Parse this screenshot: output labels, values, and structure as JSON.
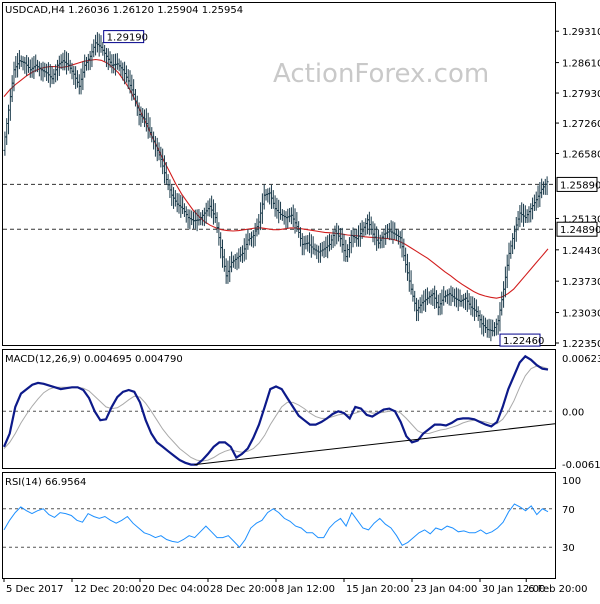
{
  "chart_data": {
    "type": "line",
    "symbol": "USDCAD",
    "timeframe": "H4",
    "header": {
      "text": "USDCAD,H4  1.26036 1.26120 1.25904 1.25954",
      "values": [
        1.26036,
        1.2612,
        1.25904,
        1.25954
      ]
    },
    "watermark": "ActionForex.com",
    "x_ticks": [
      "5 Dec 2017",
      "12 Dec 20:00",
      "20 Dec 04:00",
      "28 Dec 20:00",
      "8 Jan 12:00",
      "15 Jan 20:00",
      "23 Jan 04:00",
      "30 Jan 12:00",
      "6 Feb 20:00"
    ],
    "price_panel": {
      "ylim": [
        1.2235,
        1.2965
      ],
      "y_ticks": [
        "1.29310",
        "1.28610",
        "1.27930",
        "1.27260",
        "1.26580",
        "1.25130",
        "1.24430",
        "1.23730",
        "1.23030",
        "1.22350"
      ],
      "levels": [
        {
          "label": "1.25890",
          "value": 1.2589,
          "style": "dashed"
        },
        {
          "label": "1.24890",
          "value": 1.2489,
          "style": "dashed"
        }
      ],
      "annotations": [
        {
          "label": "1.29190",
          "x": 22,
          "value": 1.2919
        },
        {
          "label": "1.22460",
          "x": 100,
          "value": 1.2246
        }
      ],
      "close_series": [
        1.2665,
        1.2755,
        1.2845,
        1.2865,
        1.286,
        1.2845,
        1.2855,
        1.2845,
        1.2838,
        1.2825,
        1.2855,
        1.2865,
        1.2855,
        1.2835,
        1.2808,
        1.2855,
        1.2875,
        1.2905,
        1.2895,
        1.2875,
        1.2855,
        1.2858,
        1.2845,
        1.282,
        1.279,
        1.2745,
        1.2735,
        1.2705,
        1.2675,
        1.2645,
        1.26,
        1.2565,
        1.2545,
        1.2535,
        1.2515,
        1.2508,
        1.251,
        1.2525,
        1.254,
        1.2515,
        1.2448,
        1.2385,
        1.2415,
        1.2425,
        1.2435,
        1.2465,
        1.2475,
        1.2505,
        1.2565,
        1.257,
        1.2535,
        1.2522,
        1.2515,
        1.252,
        1.2495,
        1.2455,
        1.2458,
        1.2445,
        1.2438,
        1.2445,
        1.2455,
        1.2485,
        1.2468,
        1.2428,
        1.2475,
        1.2468,
        1.2485,
        1.251,
        1.2478,
        1.2458,
        1.2478,
        1.2485,
        1.2478,
        1.247,
        1.241,
        1.2355,
        1.2308,
        1.2325,
        1.2335,
        1.2345,
        1.2315,
        1.2338,
        1.2345,
        1.2335,
        1.2328,
        1.2335,
        1.2315,
        1.2305,
        1.2278,
        1.2265,
        1.2262,
        1.2285,
        1.2355,
        1.2435,
        1.2485,
        1.2525,
        1.2515,
        1.2535,
        1.2555,
        1.2578,
        1.2595
      ],
      "ma_series": [
        1.2785,
        1.28,
        1.2812,
        1.2822,
        1.2832,
        1.284,
        1.2846,
        1.285,
        1.2852,
        1.2852,
        1.285,
        1.2852,
        1.2856,
        1.286,
        1.2864,
        1.2866,
        1.2868,
        1.2866,
        1.286,
        1.285,
        1.2838,
        1.282,
        1.28,
        1.2775,
        1.2748,
        1.272,
        1.2692,
        1.2666,
        1.264,
        1.2615,
        1.259,
        1.2568,
        1.255,
        1.2532,
        1.2518,
        1.2506,
        1.2498,
        1.2492,
        1.2488,
        1.2486,
        1.2485,
        1.2486,
        1.2488,
        1.249,
        1.2492,
        1.2492,
        1.249,
        1.2488,
        1.2488,
        1.249,
        1.2492,
        1.2492,
        1.249,
        1.2488,
        1.2486,
        1.2484,
        1.2482,
        1.2481,
        1.248,
        1.2478,
        1.2476,
        1.2475,
        1.2474,
        1.2472,
        1.2471,
        1.247,
        1.2469,
        1.2468,
        1.2466,
        1.2462,
        1.2456,
        1.2448,
        1.244,
        1.2432,
        1.2424,
        1.2414,
        1.2404,
        1.2394,
        1.2385,
        1.2375,
        1.2366,
        1.2358,
        1.235,
        1.2344,
        1.234,
        1.2337,
        1.2335,
        1.2338,
        1.2345,
        1.2355,
        1.237,
        1.2385,
        1.24,
        1.2415,
        1.243,
        1.2445
      ]
    },
    "macd_panel": {
      "label": "MACD(12,26,9) 0.004695 0.004790",
      "ylim": [
        -0.00616,
        0.00623
      ],
      "y_ticks": [
        "0.006232",
        "0.00",
        "-0.006163"
      ],
      "main": [
        -0.004,
        -0.0025,
        0.0005,
        0.002,
        0.0025,
        0.003,
        0.0032,
        0.0031,
        0.0029,
        0.0027,
        0.0025,
        0.0026,
        0.0027,
        0.0027,
        0.0024,
        0.0015,
        0.0,
        -0.001,
        -0.0009,
        0.0005,
        0.0016,
        0.0022,
        0.0024,
        0.0022,
        0.001,
        -0.001,
        -0.0025,
        -0.0035,
        -0.004,
        -0.0045,
        -0.005,
        -0.0055,
        -0.0058,
        -0.006,
        -0.006,
        -0.0055,
        -0.0048,
        -0.004,
        -0.0035,
        -0.0035,
        -0.004,
        -0.0052,
        -0.0048,
        -0.0042,
        -0.003,
        -0.0015,
        0.0005,
        0.0025,
        0.0028,
        0.0025,
        0.0015,
        0.0005,
        -0.0005,
        -0.001,
        -0.0015,
        -0.0015,
        -0.0012,
        -0.0008,
        -0.0003,
        0.0,
        -0.0002,
        -0.0008,
        0.0005,
        0.0003,
        -0.0004,
        -0.0006,
        -0.0002,
        0.0002,
        0.0003,
        0.0,
        -0.0012,
        -0.0028,
        -0.0035,
        -0.0033,
        -0.0025,
        -0.002,
        -0.0015,
        -0.0015,
        -0.0016,
        -0.0013,
        -0.0009,
        -0.0008,
        -0.0008,
        -0.0009,
        -0.0012,
        -0.0015,
        -0.0017,
        -0.0012,
        0.0005,
        0.0025,
        0.004,
        0.0055,
        0.0062,
        0.0058,
        0.0052,
        0.0048,
        0.0047
      ],
      "signal": [
        -0.0042,
        -0.0035,
        -0.0025,
        -0.0013,
        -0.0003,
        0.0006,
        0.0014,
        0.0021,
        0.0025,
        0.0027,
        0.0027,
        0.0027,
        0.0027,
        0.0027,
        0.0026,
        0.0023,
        0.0017,
        0.0011,
        0.0005,
        0.0003,
        0.0004,
        0.0008,
        0.0013,
        0.0017,
        0.0016,
        0.0009,
        0.0,
        -0.001,
        -0.002,
        -0.0028,
        -0.0035,
        -0.0042,
        -0.0047,
        -0.0052,
        -0.0055,
        -0.0056,
        -0.0055,
        -0.0052,
        -0.0048,
        -0.0045,
        -0.0043,
        -0.0045,
        -0.0046,
        -0.0045,
        -0.0042,
        -0.0036,
        -0.0027,
        -0.0015,
        -0.0005,
        0.0005,
        0.001,
        0.001,
        0.0007,
        0.0003,
        -0.0002,
        -0.0006,
        -0.0008,
        -0.0008,
        -0.0006,
        -0.0004,
        -0.0003,
        -0.0004,
        -0.0002,
        0.0,
        0.0,
        -0.0002,
        -0.0002,
        -0.0001,
        0.0,
        0.0001,
        -0.0002,
        -0.0008,
        -0.0015,
        -0.0022,
        -0.0025,
        -0.0025,
        -0.0023,
        -0.0021,
        -0.002,
        -0.0018,
        -0.0016,
        -0.0013,
        -0.0011,
        -0.001,
        -0.0011,
        -0.0012,
        -0.0014,
        -0.0014,
        -0.0009,
        0.0,
        0.0012,
        0.0027,
        0.004,
        0.0048,
        0.0051,
        0.005,
        0.0048
      ],
      "trendline": [
        [
          0,
          -0.0003
        ],
        [
          100,
          -0.00085
        ]
      ]
    },
    "rsi_panel": {
      "label": "RSI(14) 66.9564",
      "ylim": [
        0,
        100
      ],
      "y_ticks": [
        "100",
        "70",
        "30",
        "0"
      ],
      "levels": [
        70,
        30
      ],
      "values": [
        48,
        58,
        66,
        72,
        68,
        65,
        68,
        70,
        64,
        61,
        66,
        65,
        63,
        58,
        56,
        65,
        62,
        60,
        62,
        58,
        55,
        58,
        62,
        55,
        50,
        45,
        43,
        40,
        42,
        38,
        36,
        35,
        38,
        42,
        40,
        46,
        52,
        46,
        40,
        40,
        42,
        36,
        30,
        38,
        50,
        55,
        58,
        66,
        70,
        66,
        60,
        57,
        52,
        50,
        45,
        45,
        40,
        40,
        50,
        56,
        60,
        52,
        66,
        58,
        50,
        48,
        55,
        60,
        54,
        50,
        42,
        32,
        35,
        40,
        45,
        48,
        44,
        50,
        48,
        52,
        50,
        46,
        47,
        45,
        45,
        48,
        44,
        46,
        50,
        56,
        67,
        75,
        72,
        68,
        73,
        64,
        70,
        67
      ]
    }
  }
}
